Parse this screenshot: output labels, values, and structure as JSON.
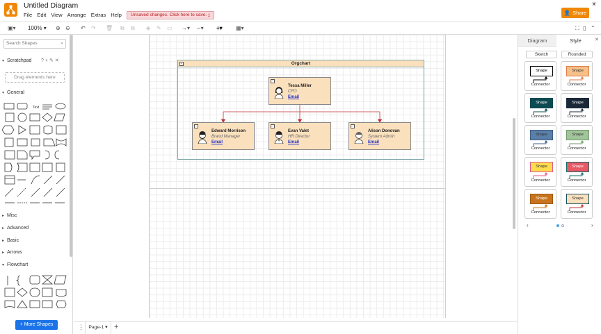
{
  "app": {
    "title": "Untitled Diagram",
    "menus": [
      "File",
      "Edit",
      "View",
      "Arrange",
      "Extras",
      "Help"
    ],
    "unsaved_notice": "Unsaved changes. Click here to save.",
    "share_label": "Share"
  },
  "toolbar": {
    "zoom": "100%"
  },
  "left_panel": {
    "search_placeholder": "Search Shapes",
    "scratchpad": "Scratchpad",
    "drag_hint": "Drag elements here",
    "sections": [
      "General",
      "Misc",
      "Advanced",
      "Basic",
      "Arrows",
      "Flowchart"
    ],
    "more_shapes": "More Shapes"
  },
  "diagram": {
    "container_title": "Orgchart",
    "people": [
      {
        "name": "Tessa Miller",
        "role": "CFO",
        "link": "Email"
      },
      {
        "name": "Edward Morrison",
        "role": "Brand Manager",
        "link": "Email"
      },
      {
        "name": "Evan Valet",
        "role": "HR Director",
        "link": "Email"
      },
      {
        "name": "Alison Donovan",
        "role": "System Admin",
        "link": "Email"
      }
    ]
  },
  "footer": {
    "page_tab": "Page-1"
  },
  "right_panel": {
    "tabs": [
      "Diagram",
      "Style"
    ],
    "style_options": [
      "Sketch",
      "Rounded"
    ],
    "style_cards": [
      {
        "shape": "Shape",
        "connector": "Connector",
        "fill": "#ffffff",
        "stroke": "#000000",
        "text": "#000000",
        "edge": "#000000"
      },
      {
        "shape": "Shape",
        "connector": "Connector",
        "fill": "#f5c08a",
        "stroke": "#e07a43",
        "text": "#333333",
        "edge": "#e07a43"
      },
      {
        "shape": "Shape",
        "connector": "Connector",
        "fill": "#0e4a52",
        "stroke": "#0e4a52",
        "text": "#ffffff",
        "edge": "#0e4a52"
      },
      {
        "shape": "Shape",
        "connector": "Connector",
        "fill": "#1b2838",
        "stroke": "#1b2838",
        "text": "#ffffff",
        "edge": "#1b2838"
      },
      {
        "shape": "Shape",
        "connector": "Connector",
        "fill": "#5a7fa8",
        "stroke": "#3e5f86",
        "text": "#333333",
        "edge": "#3e5f86"
      },
      {
        "shape": "Shape",
        "connector": "Connector",
        "fill": "#a2c49a",
        "stroke": "#6f9a68",
        "text": "#333333",
        "edge": "#6f9a68"
      },
      {
        "shape": "Shape",
        "connector": "Connector",
        "fill": "#fddc4e",
        "stroke": "#e05a8a",
        "text": "#333333",
        "edge": "#e05a8a"
      },
      {
        "shape": "Shape",
        "connector": "Connector",
        "fill": "#e85a66",
        "stroke": "#0f6a6a",
        "text": "#ffffff",
        "edge": "#0f6a6a"
      },
      {
        "shape": "Shape",
        "connector": "Connector",
        "fill": "#c8741e",
        "stroke": "#a05a14",
        "text": "#ffffff",
        "edge": "#c8741e"
      },
      {
        "shape": "Shape",
        "connector": "Connector",
        "fill": "#fbe0bd",
        "stroke": "#0f4a5a",
        "text": "#333333",
        "edge": "#c03030"
      }
    ]
  },
  "colors": {
    "brand": "#f08705",
    "card_fill": "#fbe0bd",
    "edge": "#c03030",
    "link": "#2233cc",
    "primary_button": "#1a73e8"
  }
}
